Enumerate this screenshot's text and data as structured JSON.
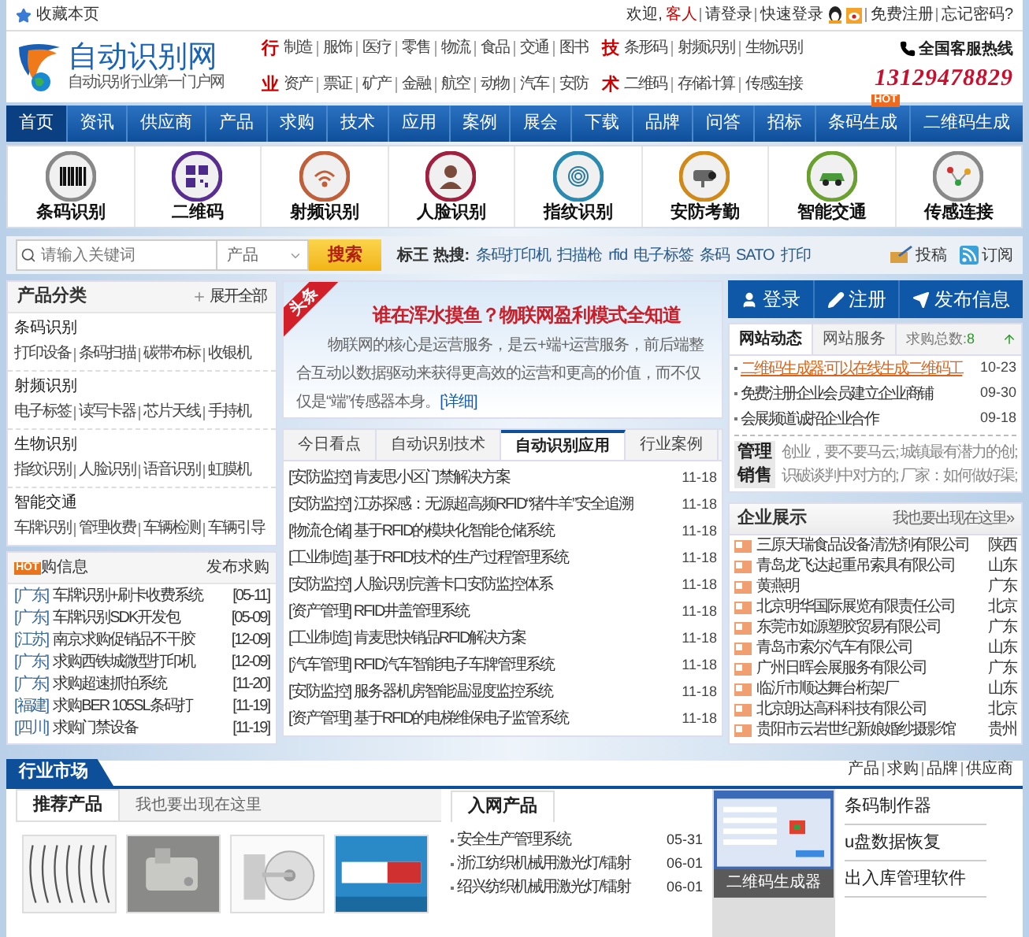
{
  "top_bar": {
    "bookmark": "收藏本页",
    "welcome": "欢迎,",
    "guest": "客人",
    "links_before": [
      "请登录",
      "快速登录"
    ],
    "links_after": [
      "免费注册",
      "忘记密码?"
    ]
  },
  "header": {
    "logo_title": "自动识别网",
    "logo_subtitle": "自动识别行业第一门户网",
    "category_rows": [
      {
        "groups": [
          {
            "label": "行",
            "links": [
              "制造",
              "服饰",
              "医疗",
              "零售",
              "物流",
              "食品",
              "交通",
              "图书"
            ]
          },
          {
            "label": "技",
            "links": [
              "条形码",
              "射频识别",
              "生物识别"
            ]
          }
        ]
      },
      {
        "groups": [
          {
            "label": "业",
            "links": [
              "资产",
              "票证",
              "矿产",
              "金融",
              "航空",
              "动物",
              "汽车",
              "安防"
            ]
          },
          {
            "label": "术",
            "links": [
              "二维码",
              "存储计算",
              "传感连接"
            ]
          }
        ]
      }
    ],
    "hotline_label": "全国客服热线",
    "hotline": "13129478829"
  },
  "nav": [
    {
      "label": "首页",
      "selected": true
    },
    {
      "label": "资讯",
      "selected": false
    },
    {
      "label": "供应商",
      "selected": false
    },
    {
      "label": "产品",
      "selected": false
    },
    {
      "label": "求购",
      "selected": false
    },
    {
      "label": "技术",
      "selected": false
    },
    {
      "label": "应用",
      "selected": false
    },
    {
      "label": "案例",
      "selected": false
    },
    {
      "label": "展会",
      "selected": false
    },
    {
      "label": "下载",
      "selected": false
    },
    {
      "label": "品牌",
      "selected": false
    },
    {
      "label": "问答",
      "selected": false
    },
    {
      "label": "招标",
      "selected": false
    },
    {
      "label": "条码生成",
      "selected": false,
      "badge": "HOT"
    },
    {
      "label": "二维码生成",
      "selected": false
    }
  ],
  "features": [
    {
      "label": "条码识别",
      "kind": "barcode"
    },
    {
      "label": "二维码",
      "kind": "qrcode"
    },
    {
      "label": "射频识别",
      "kind": "rfid"
    },
    {
      "label": "人脸识别",
      "kind": "face"
    },
    {
      "label": "指纹识别",
      "kind": "fingerprint"
    },
    {
      "label": "安防考勤",
      "kind": "camera"
    },
    {
      "label": "智能交通",
      "kind": "car"
    },
    {
      "label": "传感连接",
      "kind": "sensor"
    }
  ],
  "search": {
    "placeholder": "请输入关键词",
    "category": "产品",
    "button": "搜索",
    "hot_label": "标王 热搜:",
    "hot_links": [
      "条码打印机",
      "扫描枪",
      "rfid",
      "电子标签",
      "条码",
      "SATO",
      "打印"
    ],
    "actions": [
      {
        "label": "投稿",
        "kind": "submit"
      },
      {
        "label": "订阅",
        "kind": "rss"
      }
    ]
  },
  "product_categories": {
    "title": "产品分类",
    "expand": "展开全部",
    "groups": [
      {
        "name": "条码识别",
        "links": [
          "打印设备",
          "条码扫描",
          "碳带布标",
          "收银机"
        ]
      },
      {
        "name": "射频识别",
        "links": [
          "电子标签",
          "读写卡器",
          "芯片天线",
          "手持机"
        ]
      },
      {
        "name": "生物识别",
        "links": [
          "指纹识别",
          "人脸识别",
          "语音识别",
          "虹膜机"
        ]
      },
      {
        "name": "智能交通",
        "links": [
          "车牌识别",
          "管理收费",
          "车辆检测",
          "车辆引导"
        ]
      }
    ]
  },
  "purchase_info": {
    "badge": "HOT",
    "title": "购信息",
    "action": "发布求购",
    "items": [
      {
        "region": "[广东]",
        "title": "车牌识别+刷卡收费系统",
        "date": "[05-11]"
      },
      {
        "region": "[广东]",
        "title": "车牌识别SDK开发包",
        "date": "[05-09]"
      },
      {
        "region": "[江苏]",
        "title": "南京求购促销品不干胶",
        "date": "[12-09]"
      },
      {
        "region": "[广东]",
        "title": "求购西铁城微型打印机",
        "date": "[12-09]"
      },
      {
        "region": "[广东]",
        "title": "求购超速抓拍系统",
        "date": "[11-20]"
      },
      {
        "region": "[福建]",
        "title": "求购BER 105SL条码打",
        "date": "[11-19]"
      },
      {
        "region": "[四川]",
        "title": "求购门禁设备",
        "date": "[11-19]"
      }
    ]
  },
  "headline": {
    "ribbon": "头条",
    "title": "谁在浑水摸鱼？物联网盈利模式全知道",
    "body": "物联网的核心是运营服务，是云+端+运营服务，前后端整合互动以数据驱动来获得更高效的运营和更高的价值，而不仅仅是“端”传感器本身。",
    "more": "[详细]"
  },
  "news_tabs": [
    {
      "label": "今日看点",
      "selected": false
    },
    {
      "label": "自动识别技术",
      "selected": false
    },
    {
      "label": "自动识别应用",
      "selected": true
    },
    {
      "label": "行业案例",
      "selected": false
    }
  ],
  "news": [
    {
      "title": "[安防监控] 肯麦思小区门禁解决方案",
      "date": "11-18"
    },
    {
      "title": "[安防监控] 江苏探感：无源超高频RFID“猪牛羊”安全追溯",
      "date": "11-18"
    },
    {
      "title": "[物流仓储] 基于RFID的模块化智能仓储系统",
      "date": "11-18"
    },
    {
      "title": "[工业制造] 基于RFID技术的生产过程管理系统",
      "date": "11-18"
    },
    {
      "title": "[安防监控] 人脸识别完善卡口安防监控体系",
      "date": "11-18"
    },
    {
      "title": "[资产管理] RFID井盖管理系统",
      "date": "11-18"
    },
    {
      "title": "[工业制造] 肯麦思快销品RFID解决方案",
      "date": "11-18"
    },
    {
      "title": "[汽车管理] RFID汽车智能电子车牌管理系统",
      "date": "11-18"
    },
    {
      "title": "[安防监控] 服务器机房智能温湿度监控系统",
      "date": "11-18"
    },
    {
      "title": "[资产管理] 基于RFID的电梯维保电子监管系统",
      "date": "11-18"
    }
  ],
  "account_buttons": [
    {
      "label": "登录",
      "kind": "login"
    },
    {
      "label": "注册",
      "kind": "register"
    },
    {
      "label": "发布信息",
      "kind": "publish"
    }
  ],
  "site_tabs": [
    {
      "label": "网站动态",
      "selected": true
    },
    {
      "label": "网站服务",
      "selected": false
    }
  ],
  "purchase_total_label": "求购总数:",
  "purchase_total": "8",
  "site_news": [
    {
      "title": "二维码生成器:可以在线生成二维码工",
      "date": "10-23",
      "highlight": true
    },
    {
      "title": "免费注册企业会员建立企业商铺",
      "date": "09-30",
      "highlight": false
    },
    {
      "title": "会展频道诚招企业合作",
      "date": "09-18",
      "highlight": false
    }
  ],
  "tips": [
    {
      "tag": "管理",
      "text": "创业，要不要马云; 城镇最有潜力的创;"
    },
    {
      "tag": "销售",
      "text": "识破谈判中对方的; 厂家：如何做好渠;"
    }
  ],
  "companies": {
    "title": "企业展示",
    "more": "我也要出现在这里»",
    "items": [
      {
        "name": "三原天瑞食品设备清洗剂有限公司",
        "province": "陕西"
      },
      {
        "name": "青岛龙飞达起重吊索具有限公司",
        "province": "山东"
      },
      {
        "name": "黄燕明",
        "province": "广东"
      },
      {
        "name": "北京明华国际展览有限责任公司",
        "province": "北京"
      },
      {
        "name": "东莞市如源塑胶贸易有限公司",
        "province": "广东"
      },
      {
        "name": "青岛市索尔汽车有限公司",
        "province": "山东"
      },
      {
        "name": "广州日晖会展服务有限公司",
        "province": "广东"
      },
      {
        "name": "临沂市顺达舞台桁架厂",
        "province": "山东"
      },
      {
        "name": "北京朗达高科科技有限公司",
        "province": "北京"
      },
      {
        "name": "贵阳市云岩世纪新娘婚纱摄影馆",
        "province": "贵州"
      }
    ]
  },
  "market": {
    "title": "行业市场",
    "links": [
      "产品",
      "求购",
      "品牌",
      "供应商"
    ],
    "tabs": [
      {
        "label": "推荐产品",
        "selected": true
      },
      {
        "label": "我也要出现在这里",
        "selected": false
      }
    ],
    "new_products": {
      "title": "入网产品",
      "items": [
        {
          "title": "安全生产管理系统",
          "date": "05-31"
        },
        {
          "title": "浙江纺织机械用激光灯/镭射",
          "date": "06-01"
        },
        {
          "title": "绍兴纺织机械用激光灯/镭射",
          "date": "06-01"
        }
      ]
    },
    "software": {
      "caption": "二维码生成器",
      "links": [
        "条码制作器",
        "u盘数据恢复",
        "出入库管理软件"
      ]
    }
  }
}
